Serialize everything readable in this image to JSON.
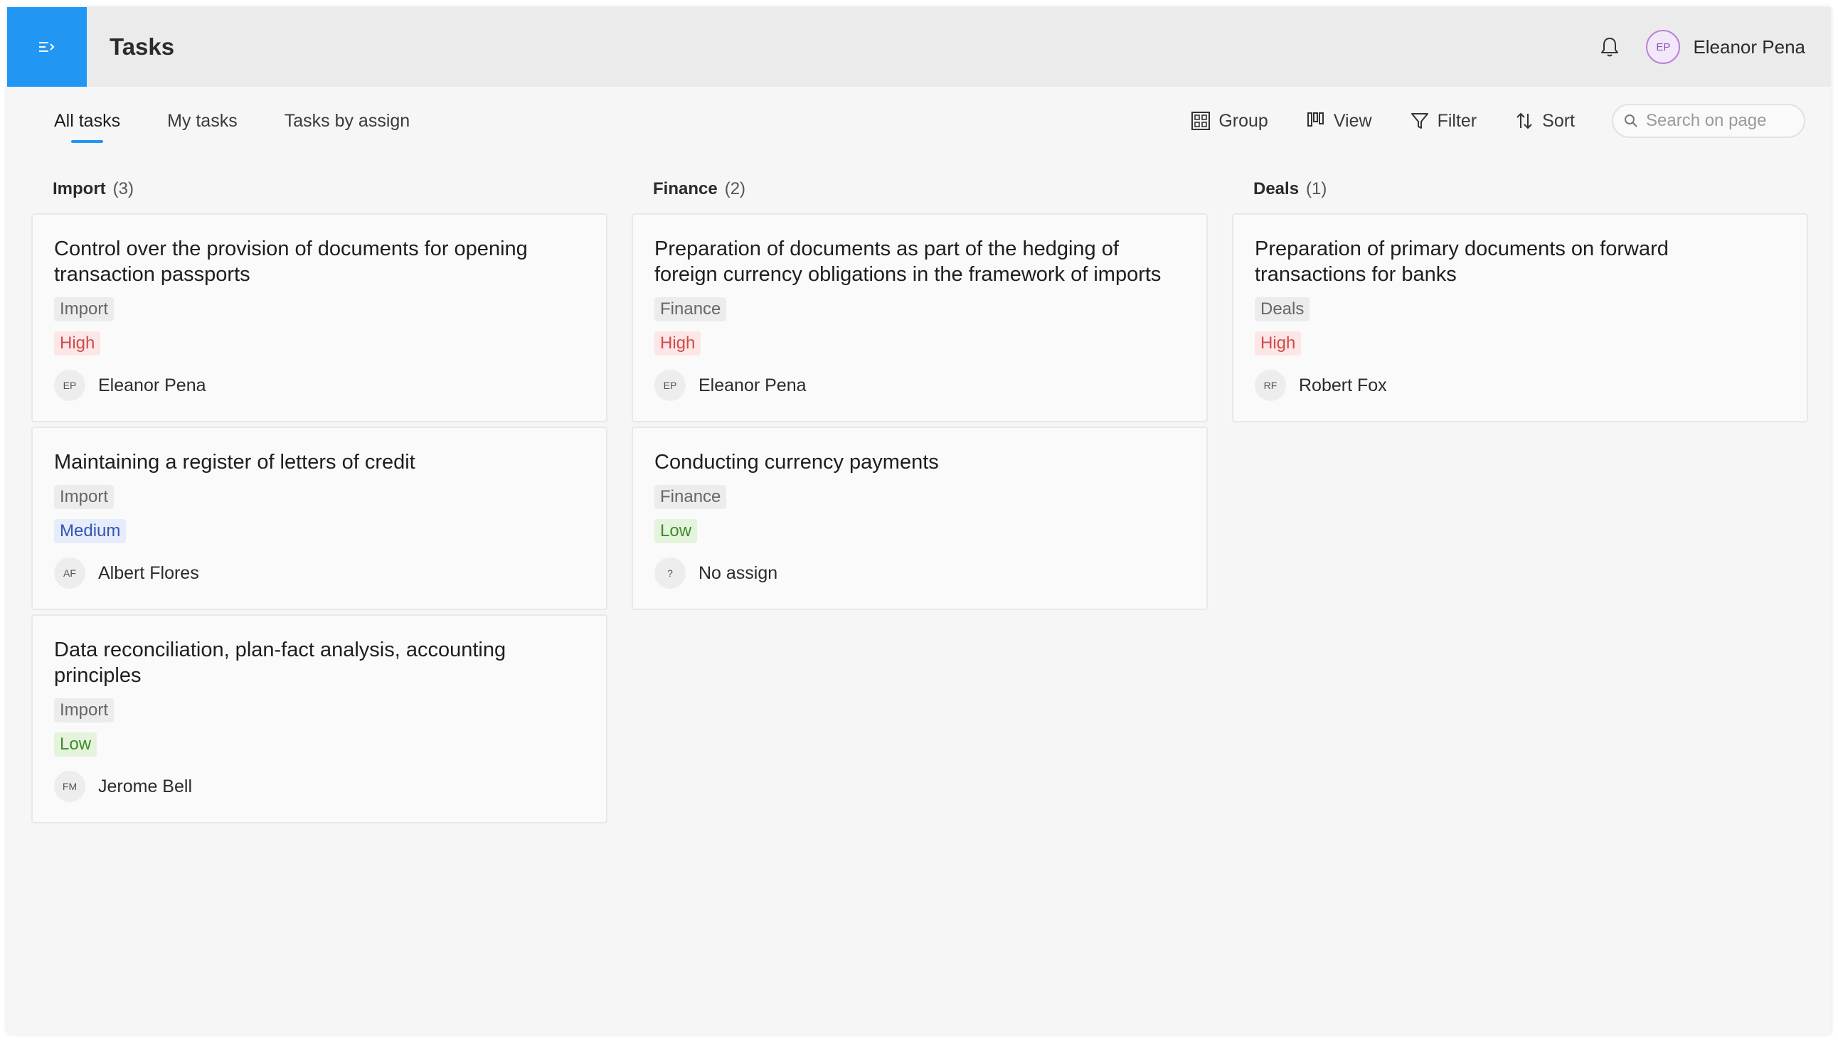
{
  "header": {
    "title": "Tasks",
    "user_initials": "EP",
    "user_name": "Eleanor Pena",
    "icons": [
      "menu-icon",
      "bell-icon"
    ]
  },
  "tabs": [
    {
      "label": "All tasks",
      "active": true
    },
    {
      "label": "My tasks",
      "active": false
    },
    {
      "label": "Tasks by assign",
      "active": false
    }
  ],
  "tools": {
    "group_label": "Group",
    "view_label": "View",
    "filter_label": "Filter",
    "sort_label": "Sort",
    "search_placeholder": "Search on page"
  },
  "colors": {
    "accent": "#2196f3",
    "high": "#d14b4b",
    "medium": "#3257b0",
    "low": "#3f8a2c"
  },
  "columns": [
    {
      "title": "Import",
      "count": "(3)",
      "cards": [
        {
          "title": "Control over the provision of documents for opening transaction passports",
          "category": "Import",
          "priority": "High",
          "assignee_initials": "EP",
          "assignee": "Eleanor Pena"
        },
        {
          "title": "Maintaining a register of letters of credit",
          "category": "Import",
          "priority": "Medium",
          "assignee_initials": "AF",
          "assignee": "Albert Flores"
        },
        {
          "title": "Data reconciliation, plan-fact analysis, accounting principles",
          "category": "Import",
          "priority": "Low",
          "assignee_initials": "FM",
          "assignee": "Jerome Bell"
        }
      ]
    },
    {
      "title": "Finance",
      "count": "(2)",
      "cards": [
        {
          "title": "Preparation of documents as part of the hedging of foreign currency obligations in the framework of imports",
          "category": "Finance",
          "priority": "High",
          "assignee_initials": "EP",
          "assignee": "Eleanor Pena"
        },
        {
          "title": "Conducting currency payments",
          "category": "Finance",
          "priority": "Low",
          "assignee_initials": "?",
          "assignee": "No assign"
        }
      ]
    },
    {
      "title": "Deals",
      "count": "(1)",
      "cards": [
        {
          "title": "Preparation of primary documents on forward transactions for banks",
          "category": "Deals",
          "priority": "High",
          "assignee_initials": "RF",
          "assignee": "Robert Fox"
        }
      ]
    }
  ]
}
